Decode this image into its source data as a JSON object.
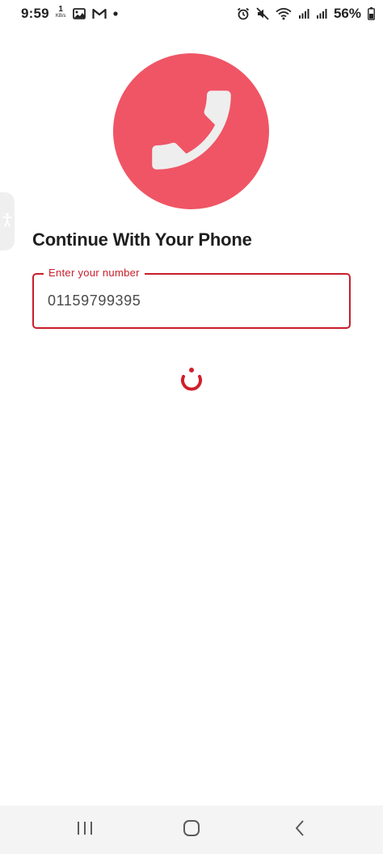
{
  "status_bar": {
    "time": "9:59",
    "net_speed_value": "1",
    "net_speed_unit": "KB/s",
    "battery_percent": "56%",
    "icons": [
      "gallery-icon",
      "gmail-icon",
      "notification-dot-icon",
      "alarm-icon",
      "mute-icon",
      "wifi-icon",
      "signal-icon",
      "signal-icon-2",
      "battery-icon"
    ]
  },
  "hero": {
    "icon": "phone-icon",
    "circle_color": "#ef5565"
  },
  "heading": "Continue With Your Phone",
  "phone_input": {
    "label": "Enter your number",
    "value": "01159799395",
    "accent_color": "#c81e2b"
  },
  "loading": {
    "icon": "loading-spinner-icon"
  },
  "side_tab": {
    "icon": "accessibility-icon"
  },
  "nav_bar": {
    "buttons": [
      "recent-apps-icon",
      "home-icon",
      "back-icon"
    ]
  }
}
